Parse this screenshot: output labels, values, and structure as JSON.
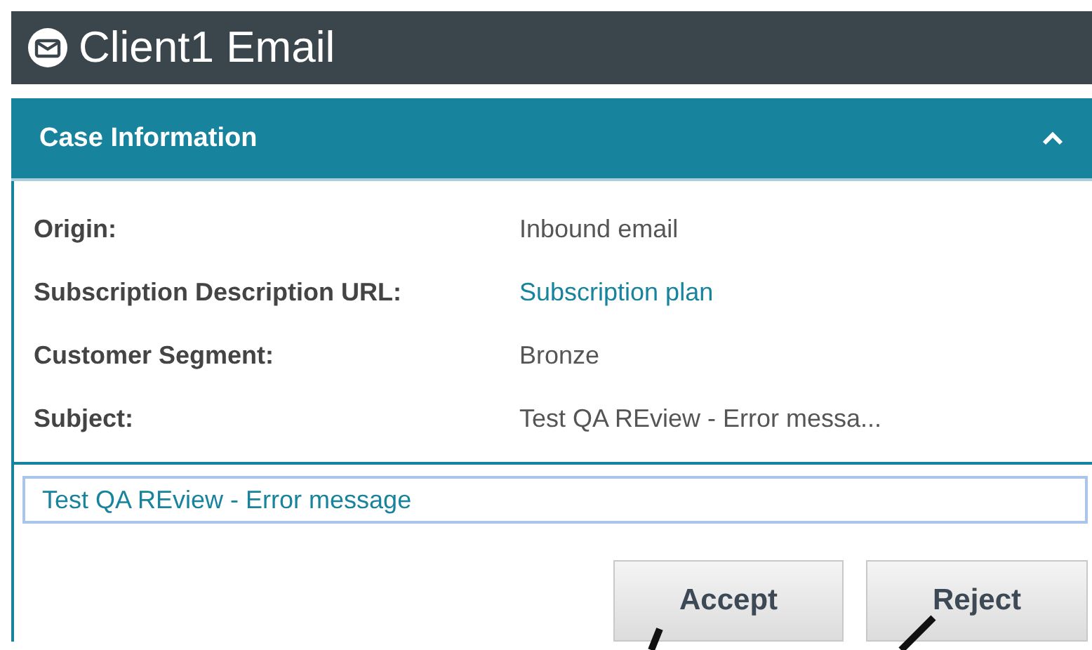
{
  "window": {
    "title": "Client1 Email"
  },
  "section": {
    "title": "Case Information",
    "expanded": true,
    "fields": [
      {
        "label": "Origin:",
        "value": "Inbound email",
        "kind": "text"
      },
      {
        "label": "Subscription Description URL:",
        "value": "Subscription plan",
        "kind": "link"
      },
      {
        "label": "Customer Segment:",
        "value": "Bronze",
        "kind": "text"
      },
      {
        "label": "Subject:",
        "value": "Test QA REview - Error messa...",
        "kind": "text"
      }
    ]
  },
  "subject_field": {
    "value": "Test QA REview - Error message"
  },
  "buttons": [
    "Accept",
    "Reject"
  ]
}
